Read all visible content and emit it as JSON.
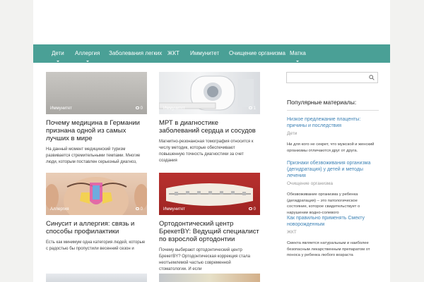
{
  "nav": {
    "items": [
      {
        "label": "Дети"
      },
      {
        "label": "Аллергия"
      },
      {
        "label": "Заболевания легких"
      },
      {
        "label": "ЖКТ"
      },
      {
        "label": "Иммунитет"
      },
      {
        "label": "Очищение организма"
      },
      {
        "label": "Матка"
      }
    ]
  },
  "articles": [
    {
      "tag": "Иммунитет",
      "comments": "0",
      "title": "Почему медицина в Германии признана одной из самых лучших в мире",
      "excerpt": "На данный момент медицинский туризм развивается стремительными темпами. Многие люди, которым поставлен серьезный диагноз,"
    },
    {
      "tag": "Иммунитет",
      "comments": "1",
      "title": "МРТ в диагностике заболеваний сердца и сосудов",
      "excerpt": "Магнитно-резонансная томография относится к числу методик, которые обеспечивают повышенную точность диагностики за счет создания"
    },
    {
      "tag": "Аллергия",
      "comments": "0",
      "title": "Синусит и аллергия: связь и способы профилактики",
      "excerpt": "Есть как минимум одна категория людей, которые с радостью бы пропустили весенний сезон и"
    },
    {
      "tag": "Иммунитет",
      "comments": "0",
      "title": "Ортодонтический центр БрекетBY: Ведущий специалист по взрослой ортодонтии",
      "excerpt": "Почему выбирают ортодонтический центр БрекетBY? Ортодонтическая коррекция стала неотъемлемой частью современной стоматологии. И если"
    }
  ],
  "sidebar": {
    "title": "Популярные материалы:",
    "items": [
      {
        "link": "Низкое предлежание плаценты: причины и последствия",
        "category": "Дети",
        "text": "Ни для кого не секрет, что мужской и женский организмы отличаются друг от друга."
      },
      {
        "link": "Признаки обезвоживания организма (дегидратация) у детей и методы лечения",
        "category": "Очищение организма",
        "text": "Обезвоживание организма у ребенка (дегидратация) – это патологическое состояние, которое свидетельствует о нарушении водно-солевого"
      },
      {
        "link": "Как правильно применять Смекту новорожденным",
        "category": "ЖКТ",
        "text": "Смекта является натуральным и наиболее безопасным лекарственным препаратом от поноса у ребенка любого возраста"
      }
    ]
  },
  "colors": {
    "nav_bg": "#4aa096",
    "link": "#3d82b5",
    "page_bg": "#f2f2f0"
  }
}
